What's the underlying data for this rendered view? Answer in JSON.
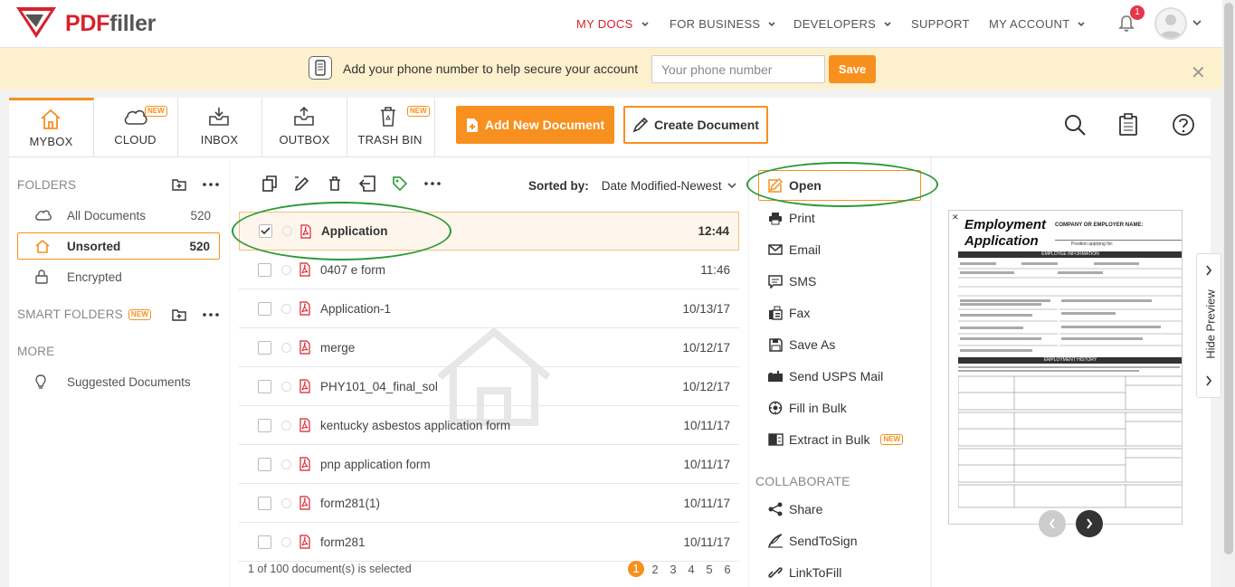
{
  "brand": {
    "logo_text_pdf": "PDF",
    "logo_text_filler": "filler"
  },
  "nav": {
    "items": [
      {
        "label": "MY DOCS",
        "active": true
      },
      {
        "label": "FOR BUSINESS"
      },
      {
        "label": "DEVELOPERS"
      },
      {
        "label": "SUPPORT"
      },
      {
        "label": "MY ACCOUNT"
      }
    ],
    "notification_count": "1"
  },
  "phone_banner": {
    "text": "Add your phone number to help secure your account",
    "placeholder": "Your phone number",
    "save_label": "Save"
  },
  "tabs": [
    {
      "label": "MYBOX",
      "icon": "home-icon",
      "active": true
    },
    {
      "label": "CLOUD",
      "icon": "cloud-icon",
      "badge": "NEW"
    },
    {
      "label": "INBOX",
      "icon": "inbox-icon"
    },
    {
      "label": "OUTBOX",
      "icon": "outbox-icon"
    },
    {
      "label": "TRASH BIN",
      "icon": "trash-icon",
      "badge": "NEW"
    }
  ],
  "toolbar": {
    "add_document": "Add New Document",
    "create_document": "Create Document"
  },
  "sidebar": {
    "folders_head": "FOLDERS",
    "items": [
      {
        "label": "All Documents",
        "count": "520"
      },
      {
        "label": "Unsorted",
        "count": "520",
        "active": true
      },
      {
        "label": "Encrypted",
        "count": ""
      }
    ],
    "smart_folders_head": "SMART FOLDERS",
    "smart_badge": "NEW",
    "more_head": "MORE",
    "more_items": [
      {
        "label": "Suggested Documents"
      }
    ]
  },
  "doclist": {
    "sorted_by_label": "Sorted by:",
    "sort_value": "Date Modified-Newest",
    "rows": [
      {
        "name": "Application",
        "date": "12:44",
        "selected": true
      },
      {
        "name": "0407 e form",
        "date": "11:46"
      },
      {
        "name": "Application-1",
        "date": "10/13/17"
      },
      {
        "name": "merge",
        "date": "10/12/17"
      },
      {
        "name": "PHY101_04_final_sol",
        "date": "10/12/17"
      },
      {
        "name": "kentucky asbestos application form",
        "date": "10/11/17"
      },
      {
        "name": "pnp application form",
        "date": "10/11/17"
      },
      {
        "name": "form281(1)",
        "date": "10/11/17"
      },
      {
        "name": "form281",
        "date": "10/11/17"
      }
    ],
    "footer": "1 of 100 document(s) is selected",
    "pages": [
      "1",
      "2",
      "3",
      "4",
      "5",
      "6"
    ],
    "current_page": "1"
  },
  "actions": {
    "items": [
      {
        "label": "Open",
        "icon": "edit-icon"
      },
      {
        "label": "Print",
        "icon": "print-icon"
      },
      {
        "label": "Email",
        "icon": "email-icon"
      },
      {
        "label": "SMS",
        "icon": "sms-icon"
      },
      {
        "label": "Fax",
        "icon": "fax-icon"
      },
      {
        "label": "Save As",
        "icon": "save-icon"
      },
      {
        "label": "Send USPS Mail",
        "icon": "mail-icon"
      },
      {
        "label": "Fill in Bulk",
        "icon": "bulk-icon"
      },
      {
        "label": "Extract in Bulk",
        "icon": "extract-icon",
        "badge": "NEW"
      }
    ],
    "collaborate_head": "COLLABORATE",
    "collaborate": [
      {
        "label": "Share",
        "icon": "share-icon"
      },
      {
        "label": "SendToSign",
        "icon": "sign-icon"
      },
      {
        "label": "LinkToFill",
        "icon": "link-icon"
      }
    ]
  },
  "preview": {
    "doc_title_1": "Employment",
    "doc_title_2": "Application",
    "company_label": "COMPANY OR EMPLOYER NAME:",
    "position_label": "Position applying for:",
    "section_1": "EMPLOYEE INFORMATION",
    "section_2": "EMPLOYMENT HISTORY",
    "hide_label": "Hide Preview"
  },
  "colors": {
    "accent": "#f7901e",
    "brand_red": "#d8212d",
    "annotation": "#2a9a3a"
  }
}
